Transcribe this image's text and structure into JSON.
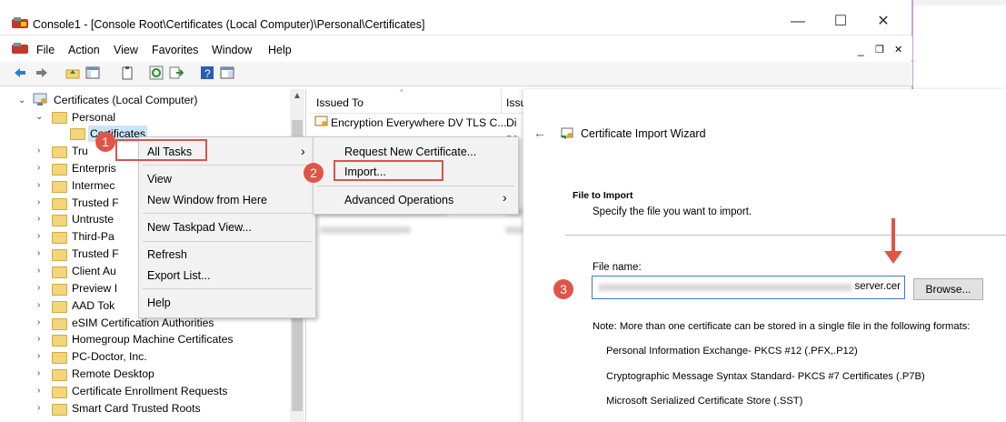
{
  "window": {
    "title": "Console1 - [Console Root\\Certificates (Local Computer)\\Personal\\Certificates]",
    "minimize_glyph": "—",
    "maximize_glyph": "☐",
    "close_glyph": "✕",
    "inner_minimize_glyph": "_",
    "inner_restore_glyph": "❐",
    "inner_close_glyph": "✕"
  },
  "menu": [
    "File",
    "Action",
    "View",
    "Favorites",
    "Window",
    "Help"
  ],
  "tree": {
    "root": "Certificates (Local Computer)",
    "personal": "Personal",
    "certificates": "Certificates",
    "items": [
      "Tru",
      "Enterpris",
      "Intermec",
      "Trusted F",
      "Untruste",
      "Third-Pa",
      "Trusted F",
      "Client Au",
      "Preview I",
      "AAD Tok",
      "eSIM Certification Authorities",
      "Homegroup Machine Certificates",
      "PC-Doctor, Inc.",
      "Remote Desktop",
      "Certificate Enrollment Requests",
      "Smart Card Trusted Roots"
    ]
  },
  "list": {
    "col1": "Issued To",
    "col2": "Issu",
    "row1_name": "Encryption Everywhere DV TLS C...",
    "row1_issuer": "Di",
    "row_issuer2": "Di",
    "row_issuer3": "Di"
  },
  "context_menu": {
    "items": [
      "All Tasks",
      "View",
      "New Window from Here",
      "New Taskpad View...",
      "Refresh",
      "Export List...",
      "Help"
    ],
    "submenu_arrow": "›"
  },
  "submenu": {
    "items": [
      "Request New Certificate...",
      "Import...",
      "Advanced Operations"
    ],
    "arrow": "›"
  },
  "badges": [
    "1",
    "2",
    "3"
  ],
  "wizard": {
    "back_glyph": "←",
    "title": "Certificate Import Wizard",
    "section_title": "File to Import",
    "section_desc": "Specify the file you want to import.",
    "file_label": "File name:",
    "file_value_visible": "server.cer",
    "browse": "Browse...",
    "note": "Note:  More than one certificate can be stored in a single file in the following formats:",
    "formats": [
      "Personal Information Exchange- PKCS #12 (.PFX,.P12)",
      "Cryptographic Message Syntax Standard- PKCS #7 Certificates (.P7B)",
      "Microsoft Serialized Certificate Store (.SST)"
    ]
  },
  "colors": {
    "highlight_red": "#d9534f",
    "badge_red": "#e05546",
    "input_border": "#3c79c9"
  }
}
